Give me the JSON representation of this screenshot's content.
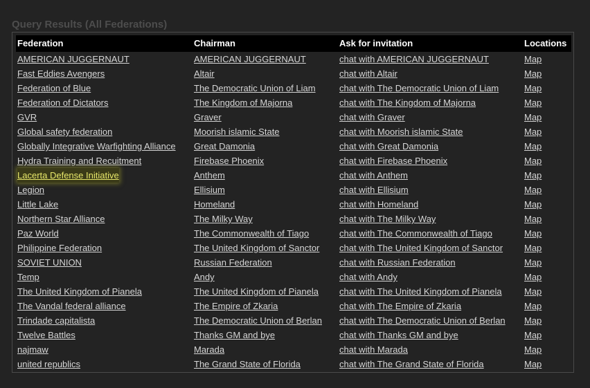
{
  "panel": {
    "title": "Query Results (All Federations)"
  },
  "table": {
    "headers": [
      "Federation",
      "Chairman",
      "Ask for invitation",
      "Locations"
    ],
    "highlight_color": "#e8e86a",
    "rows": [
      {
        "federation": "AMERICAN JUGGERNAUT",
        "chairman": "AMERICAN JUGGERNAUT",
        "invite": "chat with AMERICAN JUGGERNAUT",
        "location": "Map"
      },
      {
        "federation": "Fast Eddies Avengers",
        "chairman": "Altair",
        "invite": "chat with Altair",
        "location": "Map"
      },
      {
        "federation": "Federation of Blue",
        "chairman": "The Democratic Union of Liam",
        "invite": "chat with The Democratic Union of Liam",
        "location": "Map"
      },
      {
        "federation": "Federation of Dictators",
        "chairman": "The Kingdom of Majorna",
        "invite": "chat with The Kingdom of Majorna",
        "location": "Map"
      },
      {
        "federation": "GVR",
        "chairman": "Graver",
        "invite": "chat with Graver",
        "location": "Map"
      },
      {
        "federation": "Global safety federation",
        "chairman": "Moorish islamic State",
        "invite": "chat with Moorish islamic State",
        "location": "Map"
      },
      {
        "federation": "Globally Integrative Warfighting Alliance",
        "chairman": "Great Damonia",
        "invite": "chat with Great Damonia",
        "location": "Map"
      },
      {
        "federation": "Hydra Training and Recuitment",
        "chairman": "Firebase Phoenix",
        "invite": "chat with Firebase Phoenix",
        "location": "Map"
      },
      {
        "federation": "Lacerta Defense Initiative",
        "chairman": "Anthem",
        "invite": "chat with Anthem",
        "location": "Map",
        "highlighted": true
      },
      {
        "federation": "Legion",
        "chairman": "Ellisium",
        "invite": "chat with Ellisium",
        "location": "Map"
      },
      {
        "federation": "Little Lake",
        "chairman": "Homeland",
        "invite": "chat with Homeland",
        "location": "Map"
      },
      {
        "federation": "Northern Star Alliance",
        "chairman": "The Milky Way",
        "invite": "chat with The Milky Way",
        "location": "Map"
      },
      {
        "federation": "Paz World",
        "chairman": "The Commonwealth of Tiago",
        "invite": "chat with The Commonwealth of Tiago",
        "location": "Map"
      },
      {
        "federation": "Philippine Federation",
        "chairman": "The United Kingdom of Sanctor",
        "invite": "chat with The United Kingdom of Sanctor",
        "location": "Map"
      },
      {
        "federation": "SOVIET UNION",
        "chairman": "Russian Federation",
        "invite": "chat with Russian Federation",
        "location": "Map"
      },
      {
        "federation": "Temp",
        "chairman": "Andy",
        "invite": "chat with Andy",
        "location": "Map"
      },
      {
        "federation": "The United Kingdom of Pianela",
        "chairman": "The United Kingdom of Pianela",
        "invite": "chat with The United Kingdom of Pianela",
        "location": "Map"
      },
      {
        "federation": "The Vandal federal alliance",
        "chairman": "The Empire of Zkaria",
        "invite": "chat with The Empire of Zkaria",
        "location": "Map"
      },
      {
        "federation": "Trindade capitalista",
        "chairman": "The Democratic Union of Berlan",
        "invite": "chat with The Democratic Union of Berlan",
        "location": "Map"
      },
      {
        "federation": "Twelve Battles",
        "chairman": "Thanks GM and bye",
        "invite": "chat with Thanks GM and bye",
        "location": "Map"
      },
      {
        "federation": "najmaw",
        "chairman": "Marada",
        "invite": "chat with Marada",
        "location": "Map"
      },
      {
        "federation": "united republics",
        "chairman": "The Grand State of Florida",
        "invite": "chat with The Grand State of Florida",
        "location": "Map"
      }
    ]
  }
}
